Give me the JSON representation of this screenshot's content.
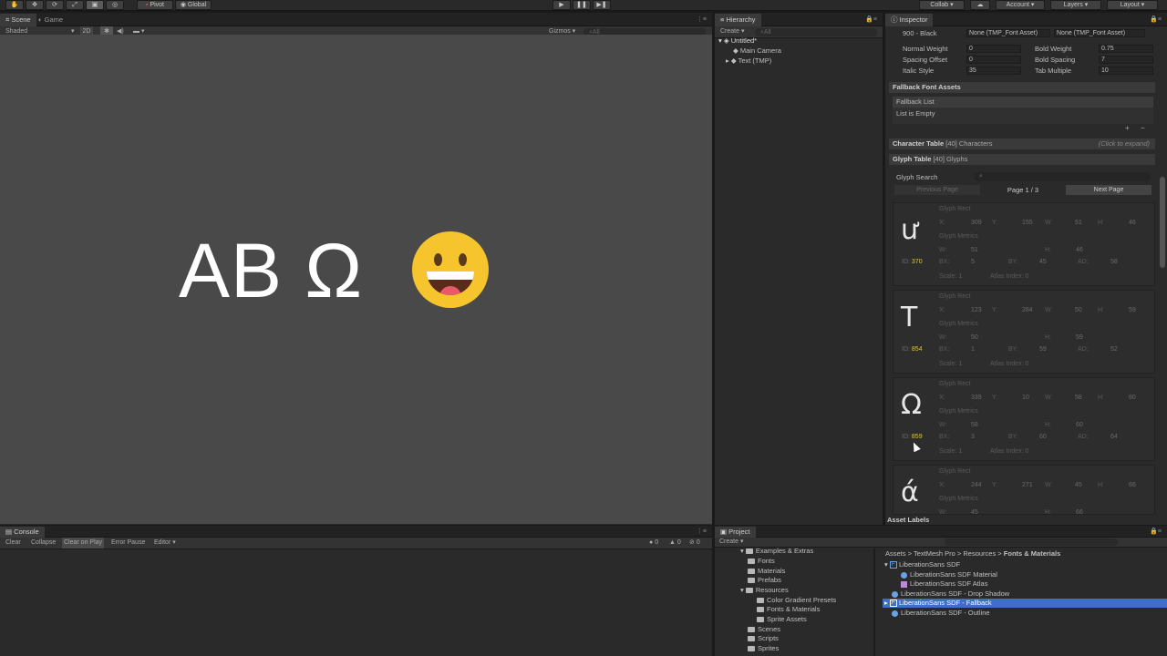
{
  "toolbar": {
    "pivot": "Pivot",
    "global": "Global",
    "collab": "Collab",
    "account": "Account",
    "layers": "Layers",
    "layout": "Layout"
  },
  "scene": {
    "tab_scene": "Scene",
    "tab_game": "Game",
    "shading": "Shaded",
    "mode_2d": "2D",
    "gizmos": "Gizmos",
    "search_placeholder": "All",
    "display_text": "AB Ω"
  },
  "hierarchy": {
    "tab": "Hierarchy",
    "create": "Create",
    "search_placeholder": "All",
    "scene_name": "Untitled*",
    "items": [
      "Main Camera",
      "Text (TMP)"
    ]
  },
  "inspector": {
    "tab": "Inspector",
    "black_label": "900 - Black",
    "black_regular": "None (TMP_Font Asset)",
    "black_italic": "None (TMP_Font Asset)",
    "normal_weight_label": "Normal Weight",
    "normal_weight": "0",
    "bold_weight_label": "Bold Weight",
    "bold_weight": "0.75",
    "spacing_offset_label": "Spacing Offset",
    "spacing_offset": "0",
    "bold_spacing_label": "Bold Spacing",
    "bold_spacing": "7",
    "italic_style_label": "Italic Style",
    "italic_style": "35",
    "tab_multiple_label": "Tab Multiple",
    "tab_multiple": "10",
    "fallback_header": "Fallback Font Assets",
    "fallback_list": "Fallback List",
    "list_empty": "List is Empty",
    "char_table": "Character Table",
    "char_count": "[40] Characters",
    "click_expand": "(Click to expand)",
    "glyph_table": "Glyph Table",
    "glyph_count": "[40] Glyphs",
    "glyph_search": "Glyph Search",
    "prev_page": "Previous Page",
    "page_info": "Page 1 / 3",
    "next_page": "Next Page",
    "asset_labels": "Asset Labels",
    "labels": {
      "glyph_rect": "Glyph Rect",
      "glyph_metrics": "Glyph Metrics",
      "x": "X:",
      "y": "Y:",
      "w": "W:",
      "h": "H:",
      "id": "ID:",
      "bx": "BX:",
      "by": "BY:",
      "ad": "AD:",
      "scale": "Scale:",
      "atlas": "Atlas Index:"
    },
    "glyphs": [
      {
        "char": "ư",
        "x": "309",
        "y": "155",
        "w": "51",
        "h": "46",
        "mw": "51",
        "mh": "46",
        "id": "370",
        "bx": "5",
        "by": "45",
        "ad": "58",
        "scale": "1",
        "atlas": "0"
      },
      {
        "char": "T",
        "x": "123",
        "y": "284",
        "w": "50",
        "h": "59",
        "mw": "50",
        "mh": "59",
        "id": "854",
        "bx": "1",
        "by": "59",
        "ad": "52",
        "scale": "1",
        "atlas": "0"
      },
      {
        "char": "Ω",
        "x": "339",
        "y": "10",
        "w": "58",
        "h": "60",
        "mw": "58",
        "mh": "60",
        "id": "859",
        "bx": "3",
        "by": "60",
        "ad": "64",
        "scale": "1",
        "atlas": "0"
      },
      {
        "char": "ά",
        "x": "244",
        "y": "271",
        "w": "45",
        "h": "66",
        "mw": "45",
        "mh": "66",
        "id": "",
        "bx": "",
        "by": "",
        "ad": "",
        "scale": "",
        "atlas": ""
      }
    ]
  },
  "console": {
    "tab": "Console",
    "clear": "Clear",
    "collapse": "Collapse",
    "clear_on_play": "Clear on Play",
    "error_pause": "Error Pause",
    "editor": "Editor",
    "info_count": "0",
    "warn_count": "0",
    "error_count": "0"
  },
  "project": {
    "tab": "Project",
    "create": "Create",
    "breadcrumb": [
      "Assets",
      "TextMesh Pro",
      "Resources",
      "Fonts & Materials"
    ],
    "folders": [
      "Examples & Extras",
      "Fonts",
      "Materials",
      "Prefabs",
      "Resources",
      "Color Gradient Presets",
      "Fonts & Materials",
      "Sprite Assets",
      "Scenes",
      "Scripts",
      "Sprites"
    ],
    "assets": [
      "LiberationSans SDF",
      "LiberationSans SDF Material",
      "LiberationSans SDF Atlas",
      "LiberationSans SDF - Drop Shadow",
      "LiberationSans SDF - Fallback",
      "LiberationSans SDF - Outline"
    ],
    "selected_color": "#3d6fc4"
  }
}
